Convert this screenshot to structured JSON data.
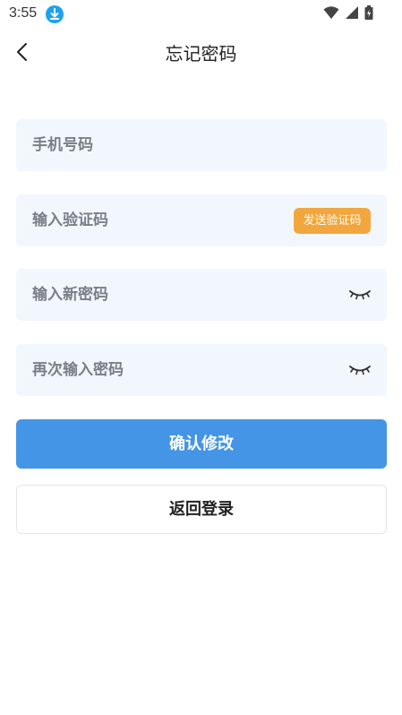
{
  "status_bar": {
    "time": "3:55"
  },
  "header": {
    "title": "忘记密码"
  },
  "form": {
    "phone_placeholder": "手机号码",
    "code_placeholder": "输入验证码",
    "send_code_label": "发送验证码",
    "new_password_placeholder": "输入新密码",
    "repeat_password_placeholder": "再次输入密码"
  },
  "actions": {
    "confirm_label": "确认修改",
    "back_login_label": "返回登录"
  },
  "colors": {
    "field_bg": "#f2f7fe",
    "send_code_bg": "#f2a63e",
    "confirm_bg": "#4495e6",
    "download_badge": "#1da1f2"
  }
}
